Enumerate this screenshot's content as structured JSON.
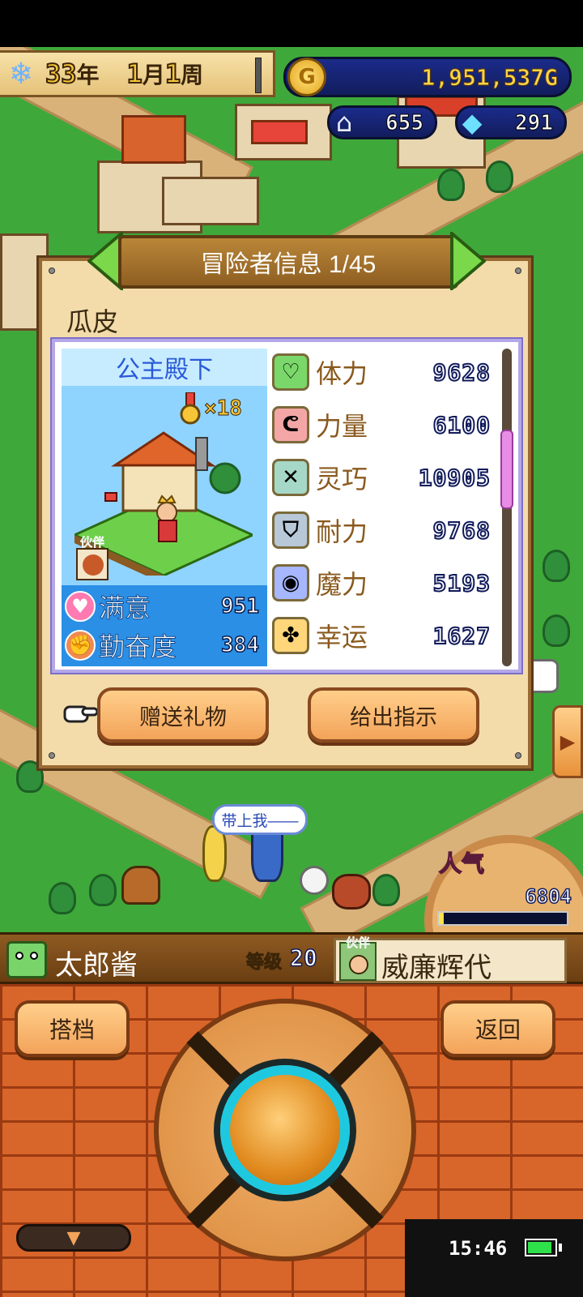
{
  "hud": {
    "season_icon": "snowflake-icon",
    "year_value": "33",
    "year_unit": "年",
    "month_value": "1",
    "month_unit": "月",
    "week_value": "1",
    "week_unit": "周",
    "gold_icon_letter": "G",
    "gold_value": "1,951,537G",
    "town_value": "655",
    "gem_value": "291"
  },
  "panel": {
    "title": "冒险者信息 1/45",
    "adventurer_name": "瓜皮",
    "rank_title": "公主殿下",
    "medal_count": "×18",
    "partner_tag": "伙伴",
    "mood": [
      {
        "label": "满意",
        "value": "951",
        "icon": "heart-icon",
        "color": "#ff7ab0"
      },
      {
        "label": "勤奋度",
        "value": "384",
        "icon": "fist-icon",
        "color": "#f08a50"
      }
    ],
    "stats": [
      {
        "label": "体力",
        "value": "9628",
        "icon": "heart-outline-icon",
        "color": "#7ad86a",
        "glyph": "♡"
      },
      {
        "label": "力量",
        "value": "6100",
        "icon": "arm-icon",
        "color": "#f4a6a6",
        "glyph": "ᕦ"
      },
      {
        "label": "灵巧",
        "value": "10905",
        "icon": "crossed-swords-icon",
        "color": "#a6d8c8",
        "glyph": "✕"
      },
      {
        "label": "耐力",
        "value": "9768",
        "icon": "shield-icon",
        "color": "#b8c8d8",
        "glyph": "⛉"
      },
      {
        "label": "魔力",
        "value": "5193",
        "icon": "magic-orb-icon",
        "color": "#a6b6ff",
        "glyph": "◉"
      },
      {
        "label": "幸运",
        "value": "1627",
        "icon": "clover-icon",
        "color": "#ffd67a",
        "glyph": "✤"
      }
    ],
    "gift_button": "赠送礼物",
    "instruct_button": "给出指示"
  },
  "world": {
    "speech_bubble": "带上我——",
    "popularity_label": "人气",
    "popularity_value": "6804",
    "popularity_fill_fraction": 0.03
  },
  "character_bar": {
    "name": "太郎酱",
    "level_label": "等级",
    "level_value": "20",
    "partner_tag": "伙伴",
    "partner_name": "威廉辉代"
  },
  "controls": {
    "partner_button": "搭档",
    "back_button": "返回"
  },
  "status": {
    "clock": "15:46",
    "battery_fill_fraction": 0.9
  },
  "colors": {
    "panel_bg": "#f3dcaa",
    "accent_blue": "#2a5ad8",
    "button_orange": "#f3a35a",
    "brick": "#d8652a"
  }
}
